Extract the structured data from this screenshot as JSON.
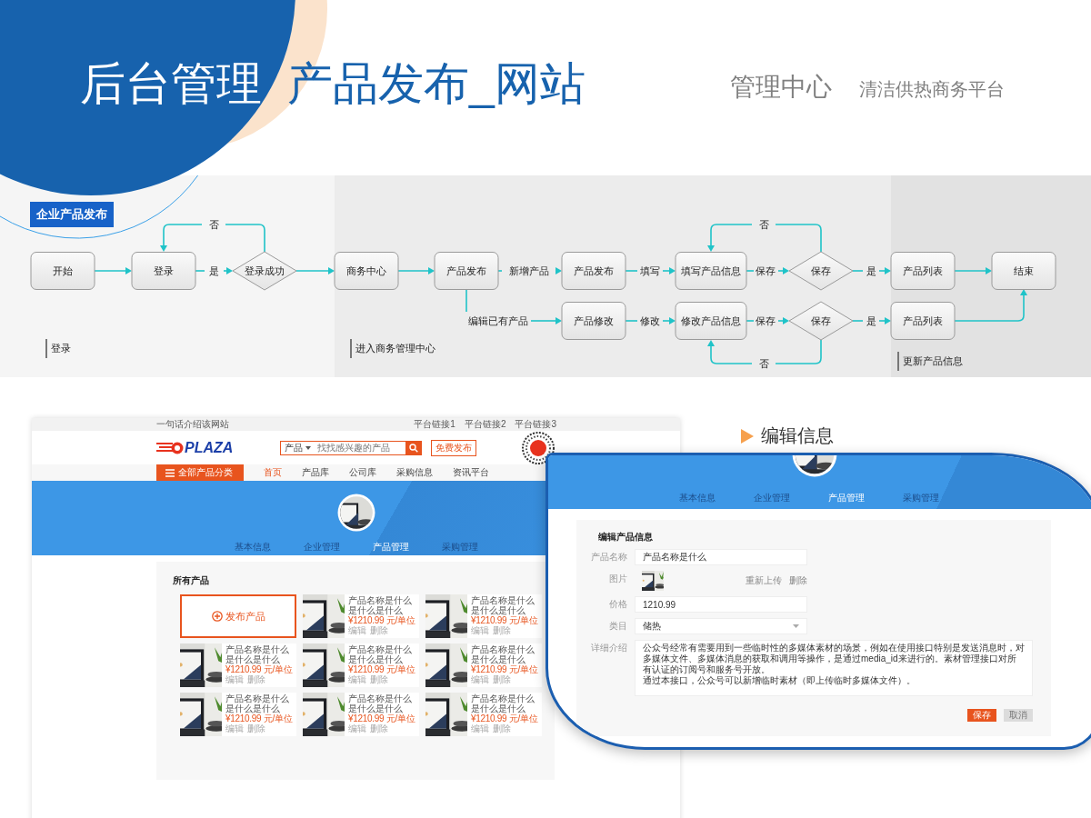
{
  "header": {
    "title": "后台管理",
    "subtitle": "产品发布_网站",
    "section": "管理中心",
    "platform": "清洁供热商务平台"
  },
  "flowchart": {
    "label": "企业产品发布",
    "phases": [
      "登录",
      "进入商务管理中心",
      "更新产品信息"
    ],
    "nodes": [
      {
        "kind": "process",
        "text": "开始"
      },
      {
        "kind": "process",
        "text": "登录"
      },
      {
        "kind": "decision",
        "text": "登录成功"
      },
      {
        "kind": "process",
        "text": "商务中心"
      },
      {
        "kind": "process",
        "text": "产品发布"
      },
      {
        "kind": "process",
        "text": "产品发布"
      },
      {
        "kind": "process",
        "text": "填写产品信息"
      },
      {
        "kind": "decision",
        "text": "保存"
      },
      {
        "kind": "process",
        "text": "产品列表"
      },
      {
        "kind": "process",
        "text": "结束"
      },
      {
        "kind": "process",
        "text": "产品修改"
      },
      {
        "kind": "process",
        "text": "修改产品信息"
      },
      {
        "kind": "decision",
        "text": "保存"
      },
      {
        "kind": "process",
        "text": "产品列表"
      }
    ],
    "edge_labels": [
      "否",
      "否",
      "是",
      "新增产品",
      "填写",
      "保存",
      "是",
      "编辑已有产品",
      "修改",
      "保存",
      "是",
      "否"
    ]
  },
  "site": {
    "tagline": "一句话介绍该网站",
    "top_links": [
      "平台链接1",
      "平台链接2",
      "平台链接3"
    ],
    "logo": "PLAZA",
    "search_category": "产品",
    "search_placeholder": "找找感兴趣的产品",
    "publish_button": "免费发布",
    "category_button": "全部产品分类",
    "nav": [
      {
        "label": "首页",
        "selected": true
      },
      {
        "label": "产品库",
        "selected": false
      },
      {
        "label": "公司库",
        "selected": false
      },
      {
        "label": "采购信息",
        "selected": false
      },
      {
        "label": "资讯平台",
        "selected": false
      }
    ],
    "tabs": [
      {
        "label": "基本信息",
        "selected": false
      },
      {
        "label": "企业管理",
        "selected": false
      },
      {
        "label": "产品管理",
        "selected": true
      },
      {
        "label": "采购管理",
        "selected": false
      }
    ],
    "section_title": "所有产品",
    "add_product": "发布产品",
    "products": [
      {
        "name": "产品名称是什么是什么是什么",
        "price": "¥1210.99 元/单位",
        "actions": [
          "编辑",
          "删除"
        ]
      },
      {
        "name": "产品名称是什么是什么是什么",
        "price": "¥1210.99 元/单位",
        "actions": [
          "编辑",
          "删除"
        ]
      },
      {
        "name": "产品名称是什么是什么是什么",
        "price": "¥1210.99 元/单位",
        "actions": [
          "编辑",
          "删除"
        ]
      },
      {
        "name": "产品名称是什么是什么是什么",
        "price": "¥1210.99 元/单位",
        "actions": [
          "编辑",
          "删除"
        ]
      },
      {
        "name": "产品名称是什么是什么是什么",
        "price": "¥1210.99 元/单位",
        "actions": [
          "编辑",
          "删除"
        ]
      },
      {
        "name": "产品名称是什么是什么是什么",
        "price": "¥1210.99 元/单位",
        "actions": [
          "编辑",
          "删除"
        ]
      },
      {
        "name": "产品名称是什么是什么是什么",
        "price": "¥1210.99 元/单位",
        "actions": [
          "编辑",
          "删除"
        ]
      },
      {
        "name": "产品名称是什么是什么是什么",
        "price": "¥1210.99 元/单位",
        "actions": [
          "编辑",
          "删除"
        ]
      }
    ]
  },
  "editor": {
    "heading": "编辑信息",
    "tabs": [
      {
        "label": "基本信息",
        "selected": false
      },
      {
        "label": "企业管理",
        "selected": false
      },
      {
        "label": "产品管理",
        "selected": true
      },
      {
        "label": "采购管理",
        "selected": false
      }
    ],
    "form_title": "编辑产品信息",
    "fields": [
      {
        "kind": "text",
        "label": "产品名称",
        "value": "产品名称是什么"
      },
      {
        "label": "图片",
        "actions": [
          "重新上传",
          "删除"
        ]
      },
      {
        "kind": "text",
        "label": "价格",
        "value": "1210.99"
      },
      {
        "kind": "select",
        "label": "类目",
        "value": "储热"
      },
      {
        "kind": "textarea",
        "label": "详细介绍",
        "paragraphs": [
          "公众号经常有需要用到一些临时性的多媒体素材的场景，例如在使用接口特别是发送消息时，对多媒体文件、多媒体消息的获取和调用等操作，是通过media_id来进行的。素材管理接口对所有认证的订阅号和服务号开放。",
          "通过本接口，公众号可以新增临时素材（即上传临时多媒体文件）。"
        ]
      }
    ],
    "buttons": [
      {
        "label": "保存",
        "disabled": false
      },
      {
        "label": "取消",
        "disabled": true
      }
    ]
  }
}
